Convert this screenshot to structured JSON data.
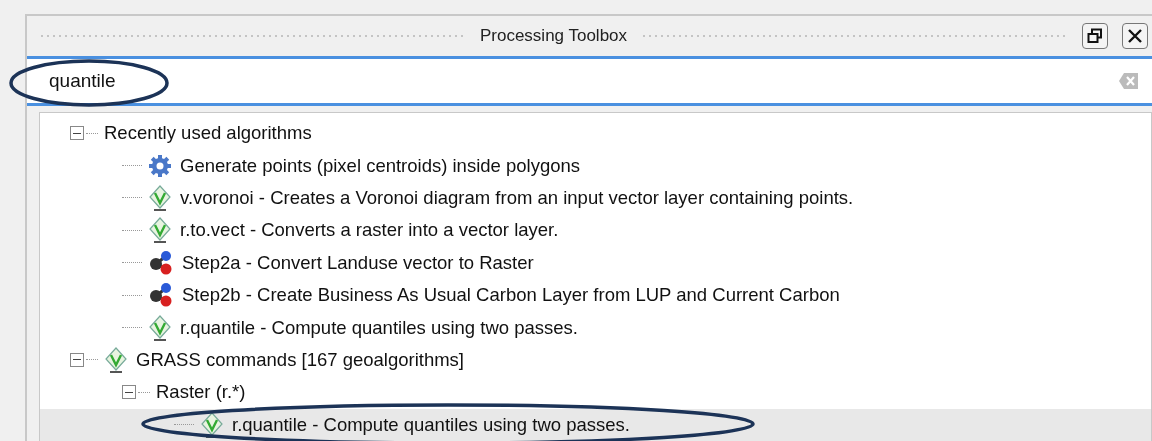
{
  "panel": {
    "title": "Processing Toolbox"
  },
  "search": {
    "value": "quantile"
  },
  "tree": [
    {
      "label": "Recently used algorithms",
      "kind": "folder",
      "expanded": true,
      "selected": false,
      "children": [
        {
          "label": "Generate points (pixel centroids) inside polygons",
          "kind": "gear",
          "selected": false
        },
        {
          "label": "v.voronoi - Creates a Voronoi diagram from an input vector layer containing points.",
          "kind": "grass",
          "selected": false
        },
        {
          "label": "r.to.vect - Converts a raster into a vector layer.",
          "kind": "grass",
          "selected": false
        },
        {
          "label": "Step2a - Convert Landuse vector to Raster",
          "kind": "model",
          "selected": false
        },
        {
          "label": "Step2b - Create Business As Usual Carbon Layer from LUP and Current Carbon",
          "kind": "model",
          "selected": false
        },
        {
          "label": "r.quantile - Compute quantiles using two passes.",
          "kind": "grass",
          "selected": false
        }
      ]
    },
    {
      "label": "GRASS commands [167 geoalgorithms]",
      "kind": "grass",
      "expanded": true,
      "selected": false,
      "children": [
        {
          "label": "Raster (r.*)",
          "kind": "folder",
          "expanded": true,
          "selected": false,
          "children": [
            {
              "label": "r.quantile - Compute quantiles using two passes.",
              "kind": "grass",
              "selected": true
            }
          ]
        }
      ]
    }
  ]
}
